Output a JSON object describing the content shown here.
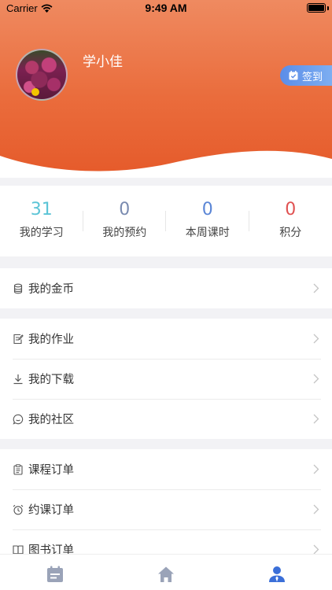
{
  "status_bar": {
    "carrier": "Carrier",
    "time": "9:49 AM"
  },
  "profile": {
    "username": "学小佳",
    "checkin_label": "签到"
  },
  "stats": [
    {
      "value": "31",
      "label": "我的学习",
      "color": "#5bc4d6"
    },
    {
      "value": "0",
      "label": "我的预约",
      "color": "#7a8bb0"
    },
    {
      "value": "0",
      "label": "本周课时",
      "color": "#5b86d6"
    },
    {
      "value": "0",
      "label": "积分",
      "color": "#e05252"
    }
  ],
  "menu": {
    "coins": "我的金币",
    "homework": "我的作业",
    "downloads": "我的下载",
    "community": "我的社区",
    "course_orders": "课程订单",
    "booking_orders": "约课订单",
    "book_orders": "图书订单"
  },
  "tabs": [
    {
      "name": "calendar-icon",
      "active": false
    },
    {
      "name": "home-icon",
      "active": false
    },
    {
      "name": "user-icon",
      "active": true
    }
  ],
  "colors": {
    "hero_top": "#ef8a60",
    "hero_bottom": "#e55a2a",
    "accent_blue": "#3b6fd8",
    "tab_inactive": "#9aa3b8"
  }
}
